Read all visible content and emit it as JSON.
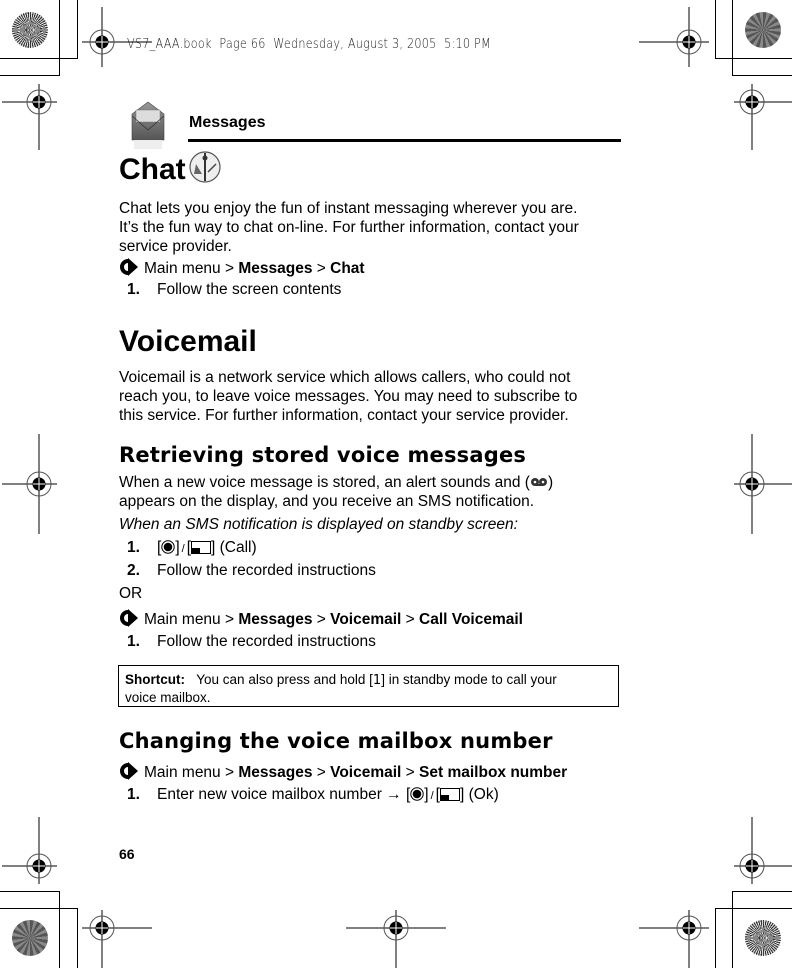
{
  "print_header": "VS7_AAA.book  Page 66  Wednesday, August 3, 2005  5:10 PM",
  "chapter": {
    "title": "Messages",
    "icon": "envelope-icon"
  },
  "chat": {
    "heading": "Chat",
    "heading_icon": "chat-satellite-icon",
    "paragraph_lines": [
      "Chat lets you enjoy the fun of instant messaging wherever you are.",
      "It’s the fun way to chat on-line. For further information, contact your",
      "service provider."
    ],
    "menu_path": {
      "prefix": "Main menu",
      "sep": " > ",
      "items": [
        "Messages",
        "Chat"
      ]
    },
    "steps": [
      {
        "n": "1.",
        "text": "Follow the screen contents"
      }
    ]
  },
  "voicemail": {
    "heading": "Voicemail",
    "paragraph_lines": [
      "Voicemail is a network service which allows callers, who could not",
      "reach you, to leave voice messages. You may need to subscribe to",
      "this service. For further information, contact your service provider."
    ]
  },
  "retrieving": {
    "heading": "Retrieving stored voice messages",
    "paragraph_line1_before": "When a new voice message is stored, an alert sounds and (",
    "paragraph_line1_after": ")",
    "paragraph_line2": "appears on the display, and you receive an SMS notification.",
    "italic_note": "When an SMS notification is displayed on standby screen:",
    "steps": [
      {
        "n": "1.",
        "text": " (Call)"
      },
      {
        "n": "2.",
        "text": "Follow the recorded instructions"
      }
    ],
    "or_label": "OR",
    "menu_path": {
      "prefix": "Main menu",
      "items": [
        "Messages",
        "Voicemail",
        "Call Voicemail"
      ]
    },
    "steps_after": [
      {
        "n": "1.",
        "text": "Follow the recorded instructions"
      }
    ],
    "shortcut": {
      "label": "Shortcut:",
      "text_before": "You can also press and hold [",
      "key": "1",
      "text_after": "] in standby mode to call your",
      "text_line2": "voice mailbox."
    }
  },
  "changing": {
    "heading": "Changing the voice mailbox number",
    "menu_path": {
      "prefix": "Main menu",
      "items": [
        "Messages",
        "Voicemail",
        "Set mailbox number"
      ]
    },
    "steps": [
      {
        "n": "1.",
        "text": "Enter new voice mailbox number",
        "arrow": "→",
        "suffix": " (Ok)"
      }
    ]
  },
  "common": {
    "sep": " > ",
    "bracket_open": "[",
    "bracket_close": "]",
    "slash": "/"
  },
  "page_number": "66"
}
